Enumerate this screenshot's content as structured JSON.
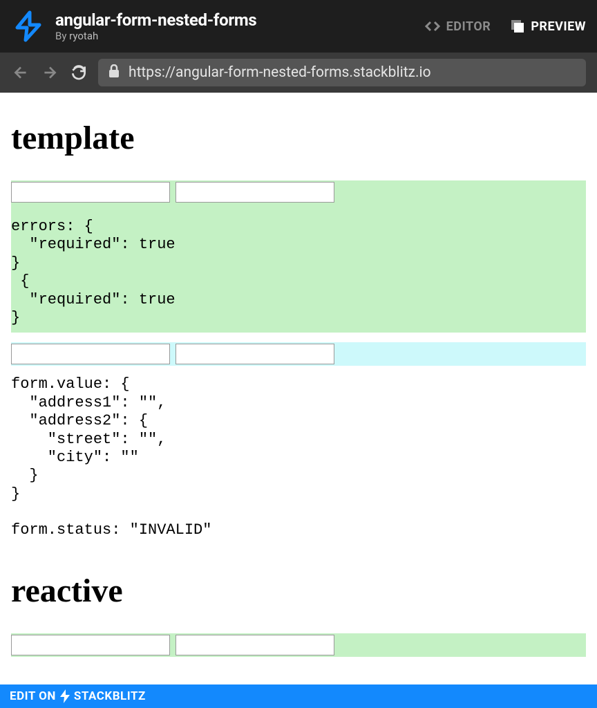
{
  "header": {
    "project_title": "angular-form-nested-forms",
    "byline_prefix": "By ",
    "author": "ryotah",
    "tabs": {
      "editor": "EDITOR",
      "preview": "PREVIEW"
    }
  },
  "urlbar": {
    "url": "https://angular-form-nested-forms.stackblitz.io"
  },
  "sections": {
    "template": {
      "heading": "template",
      "errors_block": "errors: {\n  \"required\": true\n}\n {\n  \"required\": true\n}",
      "form_value_block": "form.value: {\n  \"address1\": \"\",\n  \"address2\": {\n    \"street\": \"\",\n    \"city\": \"\"\n  }\n}\n\nform.status: \"INVALID\""
    },
    "reactive": {
      "heading": "reactive"
    }
  },
  "footer": {
    "edit_on": "EDIT ON",
    "brand": "STACKBLITZ"
  }
}
